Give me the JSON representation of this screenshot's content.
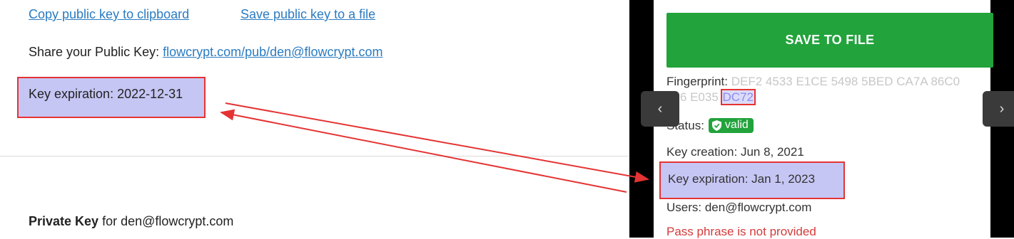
{
  "left": {
    "copy_link": "Copy public key to clipboard",
    "save_link": "Save public key to a file",
    "share_label": "Share your Public Key:",
    "share_url": "flowcrypt.com/pub/den@flowcrypt.com",
    "key_expiration": "Key expiration: 2022-12-31",
    "private_key_bold": "Private Key",
    "private_key_rest": "for den@flowcrypt.com"
  },
  "right": {
    "save_button": "SAVE TO FILE",
    "fingerprint_label": "Fingerprint:",
    "fingerprint_value": "DEF2 4533 E1CE 5498 5BED CA7A 86C0 086 E035",
    "fingerprint_highlight": "DC72",
    "status_label": "Status:",
    "status_badge": "valid",
    "key_creation": "Key creation: Jun 8, 2021",
    "key_expiration": "Key expiration: Jan 1, 2023",
    "users": "Users: den@flowcrypt.com",
    "pass_phrase": "Pass phrase is not provided"
  },
  "nav": {
    "prev": "‹",
    "next": "›"
  },
  "colors": {
    "accent_green": "#22a33c",
    "link_blue": "#2a7bc1",
    "highlight_box": "#c6c6f5",
    "annotation_red": "#e53333"
  }
}
